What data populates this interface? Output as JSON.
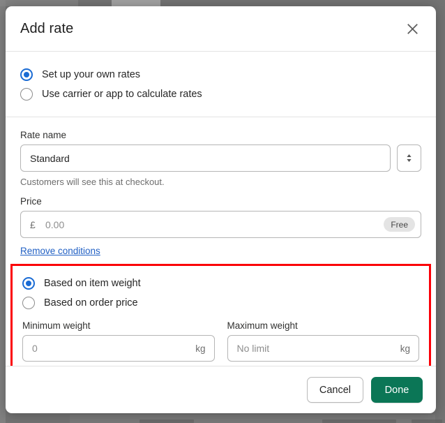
{
  "modal": {
    "title": "Add rate",
    "close_icon": "close-icon"
  },
  "rate_source": {
    "options": [
      {
        "label": "Set up your own rates",
        "selected": true
      },
      {
        "label": "Use carrier or app to calculate rates",
        "selected": false
      }
    ]
  },
  "rate_name": {
    "label": "Rate name",
    "value": "Standard",
    "placeholder": "",
    "stepper_icon": "chevron-up-down-icon",
    "help_text": "Customers will see this at checkout."
  },
  "price": {
    "label": "Price",
    "currency_symbol": "£",
    "value": "0.00",
    "placeholder": "0.00",
    "badge": "Free"
  },
  "remove_conditions": {
    "label": "Remove conditions"
  },
  "conditions": {
    "highlight_color": "#fb0007",
    "options": [
      {
        "label": "Based on item weight",
        "selected": true
      },
      {
        "label": "Based on order price",
        "selected": false
      }
    ],
    "minimum_weight": {
      "label": "Minimum weight",
      "placeholder": "0",
      "value": "",
      "unit": "kg"
    },
    "maximum_weight": {
      "label": "Maximum weight",
      "placeholder": "No limit",
      "value": "",
      "unit": "kg"
    }
  },
  "footer": {
    "cancel_label": "Cancel",
    "done_label": "Done",
    "done_color": "#0b7656"
  }
}
